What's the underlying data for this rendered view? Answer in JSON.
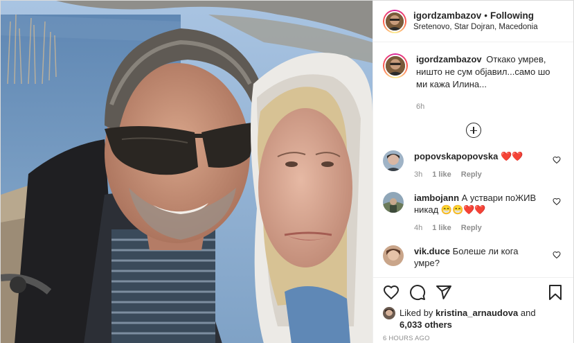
{
  "post": {
    "username": "igordzambazov",
    "follow_status": "Following",
    "separator": "•",
    "location": "Sretenovo, Star Dojran, Macedonia"
  },
  "caption": {
    "username": "igordzambazov",
    "text": "Откако умрев, ништо не сум објавил...само шо ми кажа Илина...",
    "time": "6h"
  },
  "comments": [
    {
      "username": "popovskapopovska",
      "text": "",
      "emojis": "❤️❤️",
      "time": "3h",
      "likes": "1 like",
      "reply": "Reply",
      "avatar_color": "#3a4148"
    },
    {
      "username": "iambojann",
      "text": "А уствари поЖИВ никад",
      "emojis": "😁😁❤️❤️",
      "time": "4h",
      "likes": "1 like",
      "reply": "Reply",
      "avatar_color": "#7a8a6a"
    },
    {
      "username": "vik.duce",
      "text": "Болеше ли кога умре?",
      "emojis": "",
      "time": "",
      "likes": "",
      "reply": "",
      "avatar_color": "#c9a58a"
    }
  ],
  "likes": {
    "prefix": "Liked by",
    "user": "kristina_arnaudova",
    "and": "and",
    "others": "6,033 others"
  },
  "timestamp": "6 HOURS AGO",
  "icons": {
    "like": "heart-icon",
    "comment": "comment-icon",
    "share": "paper-plane-icon",
    "save": "bookmark-icon",
    "more_comments": "plus-circle-icon",
    "comment_like": "small-heart-icon"
  },
  "colors": {
    "text": "#262626",
    "muted": "#8e8e8e",
    "heart": "#ed4956",
    "border": "#dbdbdb"
  }
}
